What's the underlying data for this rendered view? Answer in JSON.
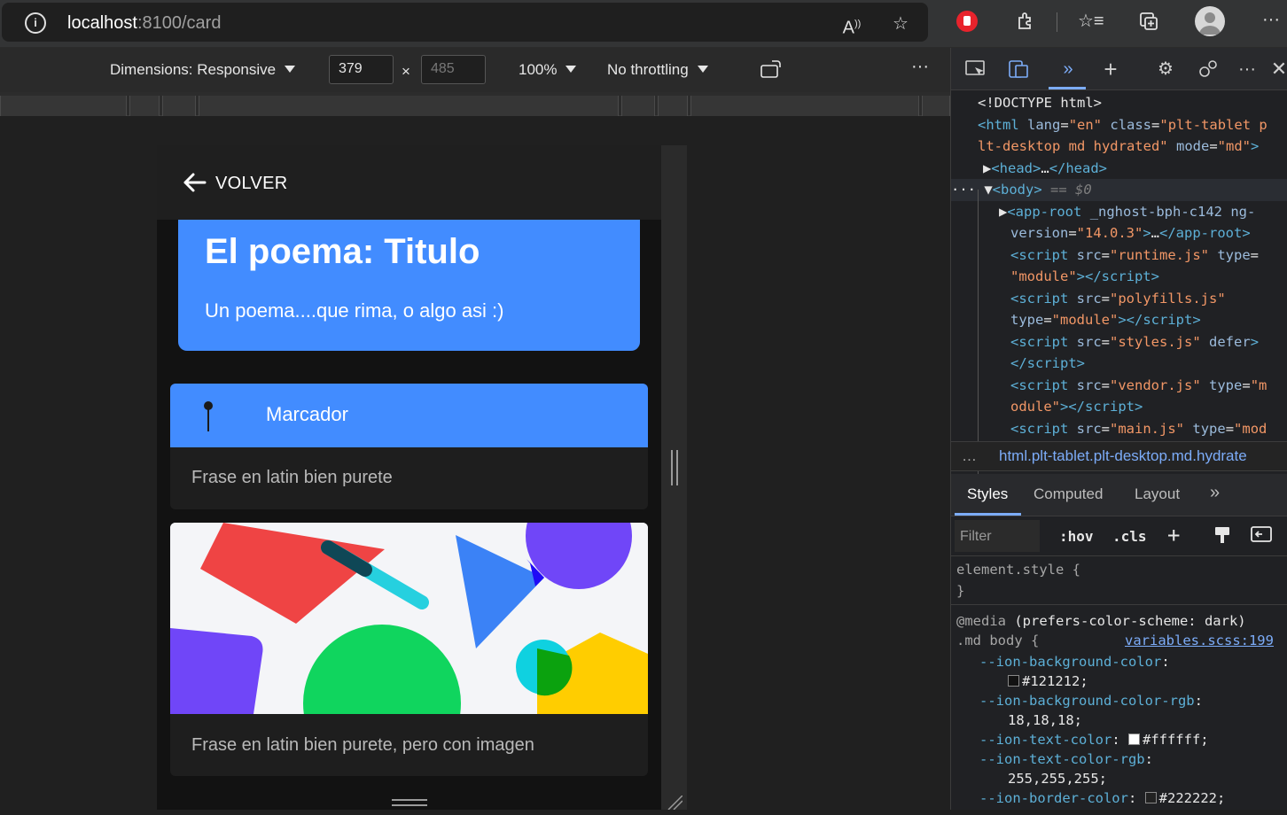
{
  "browser": {
    "url_host": "localhost",
    "url_rest": ":8100/card"
  },
  "device_toolbar": {
    "dimensions_label": "Dimensions: Responsive",
    "width_value": "379",
    "height_placeholder": "485",
    "zoom": "100%",
    "throttling": "No throttling"
  },
  "app": {
    "back_label": "VOLVER",
    "hero_title": "El poema: Titulo",
    "hero_subtitle": "Un poema....que rima, o algo asi :)",
    "card1_header": "Marcador",
    "card1_text": "Frase en latin bien purete",
    "card2_text": "Frase en latin bien purete, pero con imagen"
  },
  "devtools": {
    "breadcrumb": "html.plt-tablet.plt-desktop.md.hydrate",
    "style_tabs": [
      "Styles",
      "Computed",
      "Layout"
    ],
    "filter_placeholder": "Filter",
    "hov": ":hov",
    "cls": ".cls"
  },
  "colors": {
    "accent": "#428cff",
    "background": "#121212"
  }
}
